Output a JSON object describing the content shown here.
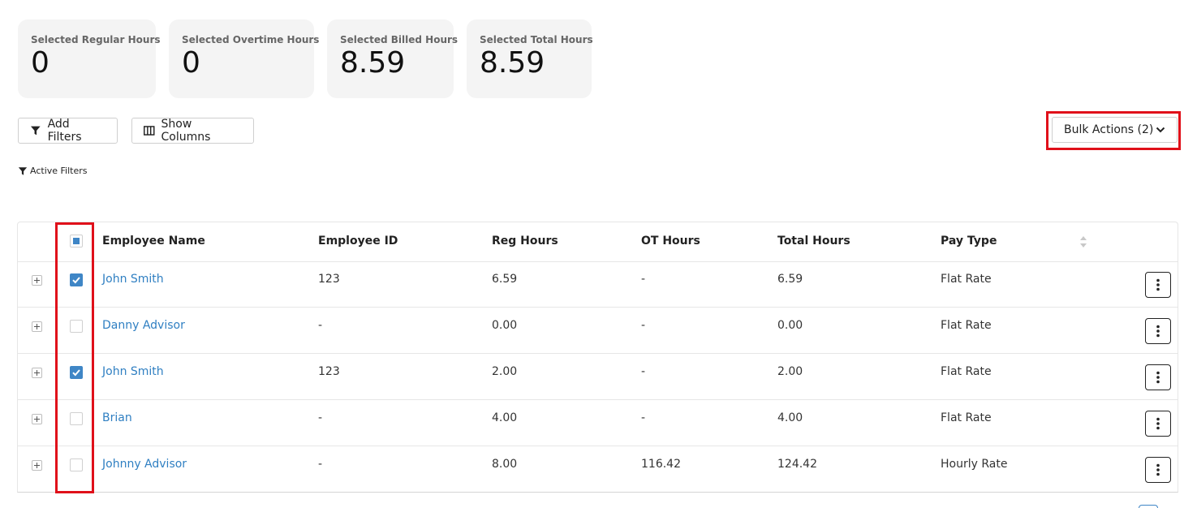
{
  "stats": [
    {
      "label": "Selected Regular Hours",
      "value": "0"
    },
    {
      "label": "Selected Overtime Hours",
      "value": "0"
    },
    {
      "label": "Selected Billed Hours",
      "value": "8.59"
    },
    {
      "label": "Selected Total Hours",
      "value": "8.59"
    }
  ],
  "toolbar": {
    "add_filters_label": "Add Filters",
    "show_columns_label": "Show Columns",
    "bulk_actions_label": "Bulk Actions (2)",
    "active_filters_label": "Active Filters"
  },
  "table": {
    "columns": [
      "Employee Name",
      "Employee ID",
      "Reg Hours",
      "OT Hours",
      "Total Hours",
      "Pay Type"
    ],
    "rows": [
      {
        "name": "John Smith",
        "id": "123",
        "reg": "6.59",
        "ot": "-",
        "total": "6.59",
        "pay": "Flat Rate",
        "checked": true
      },
      {
        "name": "Danny Advisor",
        "id": "-",
        "reg": "0.00",
        "ot": "-",
        "total": "0.00",
        "pay": "Flat Rate",
        "checked": false
      },
      {
        "name": "John Smith",
        "id": "123",
        "reg": "2.00",
        "ot": "-",
        "total": "2.00",
        "pay": "Flat Rate",
        "checked": true
      },
      {
        "name": "Brian",
        "id": "-",
        "reg": "4.00",
        "ot": "-",
        "total": "4.00",
        "pay": "Flat Rate",
        "checked": false
      },
      {
        "name": "Johnny Advisor",
        "id": "-",
        "reg": "8.00",
        "ot": "116.42",
        "total": "124.42",
        "pay": "Hourly Rate",
        "checked": false
      }
    ]
  },
  "colors": {
    "link": "#2f7fc2",
    "checkbox_accent": "#3f86c6",
    "highlight": "#e0101a",
    "card_bg": "#f4f4f4"
  },
  "icons": {
    "add_filters": "filter-icon",
    "show_columns": "columns-icon",
    "bulk_actions": "chevron-down-icon",
    "row_menu": "kebab-menu-icon",
    "row_expand": "plus-icon",
    "sort": "sort-icon"
  }
}
